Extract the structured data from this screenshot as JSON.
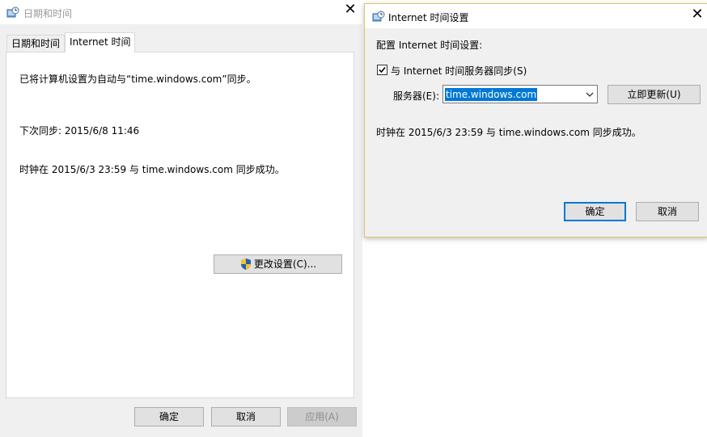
{
  "back_window": {
    "title": "日期和时间",
    "tabs": [
      "日期和时间",
      "Internet 时间"
    ],
    "active_tab": 1,
    "panel": {
      "sync_status": "已将计算机设置为自动与“time.windows.com”同步。",
      "next_sync": "下次同步: 2015/6/8 11:46",
      "last_sync": "时钟在 2015/6/3 23:59 与 time.windows.com 同步成功。",
      "change_settings_label": "更改设置(C)..."
    },
    "buttons": {
      "ok": "确定",
      "cancel": "取消",
      "apply": "应用(A)"
    }
  },
  "dialog": {
    "title": "Internet 时间设置",
    "heading": "配置 Internet 时间设置:",
    "sync_checkbox_label": "与 Internet 时间服务器同步(S)",
    "sync_checked": true,
    "server_label": "服务器(E):",
    "server_value": "time.windows.com",
    "update_now_label": "立即更新(U)",
    "status": "时钟在 2015/6/3 23:59 与 time.windows.com 同步成功。",
    "buttons": {
      "ok": "确定",
      "cancel": "取消"
    }
  },
  "icons": {
    "window_icon": "clock-network-icon",
    "close": "close-icon",
    "shield": "uac-shield-icon",
    "dropdown": "chevron-down-icon",
    "check": "checkmark-icon"
  },
  "colors": {
    "accent": "#0078d7",
    "dialog_border": "#e5c365",
    "shield_blue": "#2a5db0",
    "shield_yellow": "#f2c230"
  }
}
